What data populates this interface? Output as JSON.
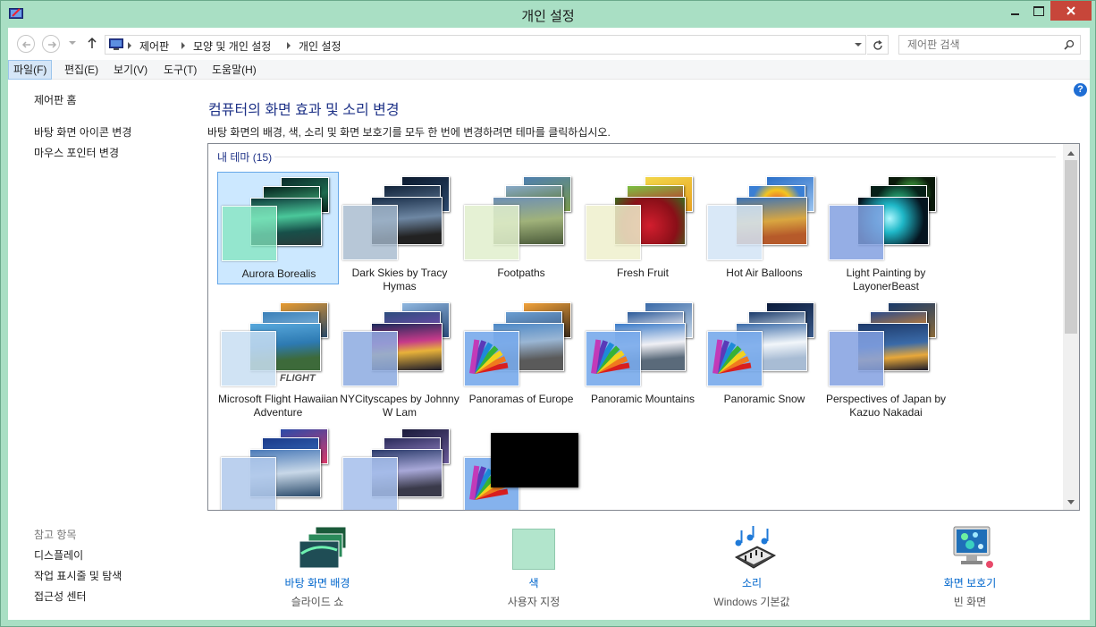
{
  "window": {
    "title": "개인 설정"
  },
  "colors": {
    "titlebar": "#a9dfc4",
    "close_button": "#c7463a",
    "heading": "#1e3287",
    "link": "#0066cc",
    "selection": "#cce8ff",
    "accent_color_swatch": "#b2e5cc"
  },
  "address": {
    "crumbs": [
      "제어판",
      "모양 및 개인 설정",
      "개인 설정"
    ]
  },
  "search": {
    "placeholder": "제어판 검색"
  },
  "menu": {
    "items": [
      "파일(F)",
      "편집(E)",
      "보기(V)",
      "도구(T)",
      "도움말(H)"
    ]
  },
  "sidebar": {
    "home": "제어판 홈",
    "links": [
      "바탕 화면 아이콘 변경",
      "마우스 포인터 변경"
    ],
    "see_also_title": "참고 항목",
    "see_also": [
      "디스플레이",
      "작업 표시줄 및 탐색",
      "접근성 센터"
    ]
  },
  "main": {
    "heading": "컴퓨터의 화면 효과 및 소리 변경",
    "description": "바탕 화면의 배경, 색, 소리 및 화면 보호기를 모두 한 번에 변경하려면 테마를 클릭하십시오.",
    "group_title": "내 테마 (15)"
  },
  "themes": [
    {
      "name": "Aurora Borealis",
      "selected": true,
      "icon": "aurora-thumbnail"
    },
    {
      "name": "Dark Skies by Tracy Hymas",
      "icon": "dark-skies-thumbnail"
    },
    {
      "name": "Footpaths",
      "icon": "footpaths-thumbnail"
    },
    {
      "name": "Fresh Fruit",
      "icon": "fresh-fruit-thumbnail"
    },
    {
      "name": "Hot Air Balloons",
      "icon": "hot-air-balloons-thumbnail"
    },
    {
      "name": "Light Painting by LayonerBeast",
      "icon": "light-painting-thumbnail"
    },
    {
      "name": "Microsoft Flight Hawaiian Adventure",
      "icon": "microsoft-flight-thumbnail",
      "logo_text": "FLIGHT"
    },
    {
      "name": "NYCityscapes by Johnny W Lam",
      "icon": "nycityscapes-thumbnail"
    },
    {
      "name": "Panoramas of Europe",
      "icon": "panoramas-europe-thumbnail"
    },
    {
      "name": "Panoramic Mountains",
      "icon": "panoramic-mountains-thumbnail"
    },
    {
      "name": "Panoramic Snow",
      "icon": "panoramic-snow-thumbnail"
    },
    {
      "name": "Perspectives of Japan by Kazuo Nakadai",
      "icon": "perspectives-japan-thumbnail"
    },
    {
      "name": "",
      "icon": "partial-theme-thumbnail"
    },
    {
      "name": "",
      "icon": "partial-theme-thumbnail"
    },
    {
      "name": "",
      "icon": "black-theme-thumbnail"
    }
  ],
  "bottom": [
    {
      "label": "바탕 화면 배경",
      "value": "슬라이드 쇼",
      "icon": "desktop-background-icon"
    },
    {
      "label": "색",
      "value": "사용자 지정",
      "icon": "color-swatch-icon"
    },
    {
      "label": "소리",
      "value": "Windows 기본값",
      "icon": "sounds-icon"
    },
    {
      "label": "화면 보호기",
      "value": "빈 화면",
      "icon": "screen-saver-icon"
    }
  ]
}
